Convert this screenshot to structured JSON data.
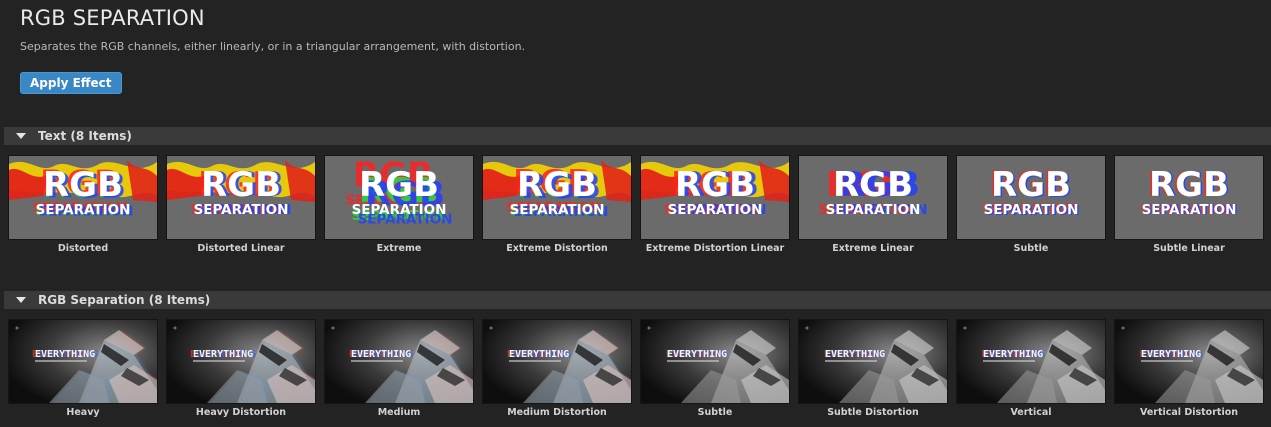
{
  "header": {
    "title": "RGB SEPARATION",
    "description": "Separates the RGB channels, either linearly, or in a triangular arrangement, with distortion.",
    "apply_label": "Apply Effect"
  },
  "sections": [
    {
      "title": "Text (8 Items)",
      "preview_text": {
        "big": "RGB",
        "small": "SEPARATION"
      },
      "items": [
        {
          "label": "Distorted"
        },
        {
          "label": "Distorted Linear"
        },
        {
          "label": "Extreme"
        },
        {
          "label": "Extreme Distortion"
        },
        {
          "label": "Extreme Distortion Linear"
        },
        {
          "label": "Extreme Linear"
        },
        {
          "label": "Subtle"
        },
        {
          "label": "Subtle Linear"
        }
      ]
    },
    {
      "title": "RGB Separation (8 Items)",
      "preview_text": {
        "big": "EVERYTHING"
      },
      "items": [
        {
          "label": "Heavy"
        },
        {
          "label": "Heavy Distortion"
        },
        {
          "label": "Medium"
        },
        {
          "label": "Medium Distortion"
        },
        {
          "label": "Subtle"
        },
        {
          "label": "Subtle Distortion"
        },
        {
          "label": "Vertical"
        },
        {
          "label": "Vertical Distortion"
        }
      ]
    }
  ],
  "colors": {
    "background": "#232323",
    "section_bar": "#3a3a3a",
    "button": "#3a87c6",
    "thumb_gray": "#6b6b6b",
    "thumb_dark": "#151515"
  },
  "icons": {
    "section_toggle": "triangle-down-icon"
  }
}
